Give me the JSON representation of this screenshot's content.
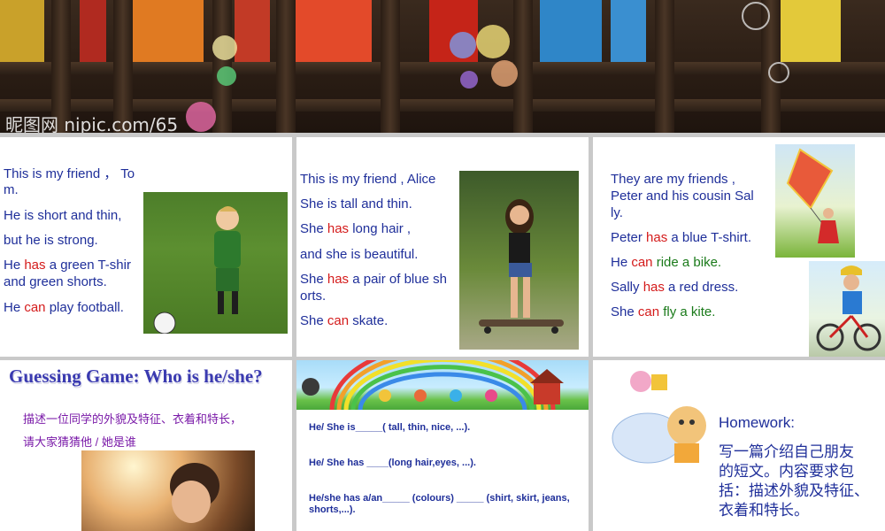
{
  "banner": {
    "watermark": "昵图网 nipic.com/65"
  },
  "panel1": {
    "lines": [
      "This is my friend ， To",
      "m.",
      "He is short and thin,",
      "but he is strong."
    ],
    "line5_pre": "He ",
    "line5_has": "has",
    "line5_post": " a green T-shir",
    "line6": "and  green shorts.",
    "line7_pre": "He ",
    "line7_can": "can",
    "line7_post": " play football."
  },
  "panel2": {
    "line1": "This is my friend ,  Alice",
    "line2": "She is tall and thin.",
    "line3_pre": "She ",
    "line3_has": "has",
    "line3_post": " long hair ,",
    "line4": "and she is beautiful.",
    "line5_pre": "She ",
    "line5_has": "has",
    "line5_post": " a pair of blue sh",
    "line6": "orts.",
    "line7_pre": "She ",
    "line7_can": "can",
    "line7_post": " skate."
  },
  "panel3": {
    "line1": "They are my friends ,",
    "line2": "Peter and his cousin Sal",
    "line3": "ly.",
    "line4_pre": "Peter ",
    "line4_has": "has",
    "line4_post": " a blue T-shirt.",
    "line5_pre": "He ",
    "line5_can": "can",
    "line5_post": " ride a bike.",
    "line6_pre": "Sally ",
    "line6_has": "has",
    "line6_post": " a red dress.",
    "line7_pre": "She ",
    "line7_can": "can",
    "line7_post": " fly a kite."
  },
  "panel4": {
    "title": "Guessing Game: Who is he/she?",
    "cn1": "描述一位同学的外貌及特征、衣着和特长，",
    "cn2": "请大家猜猜他 / 她是谁"
  },
  "panel5": {
    "ws1": "He/ She is_____( tall,  thin, nice, ...).",
    "ws2": "He/ She has ____(long hair,eyes, ...).",
    "ws3": "He/she has a/an_____ (colours) _____ (shirt, skirt, jeans,",
    "ws4": "shorts,...)."
  },
  "panel6": {
    "homework": "Homework:",
    "hw1": "写一篇介绍自己朋友",
    "hw2": "的短文。内容要求包",
    "hw3": "括：描述外貌及特征、",
    "hw4": "衣着和特长。"
  }
}
